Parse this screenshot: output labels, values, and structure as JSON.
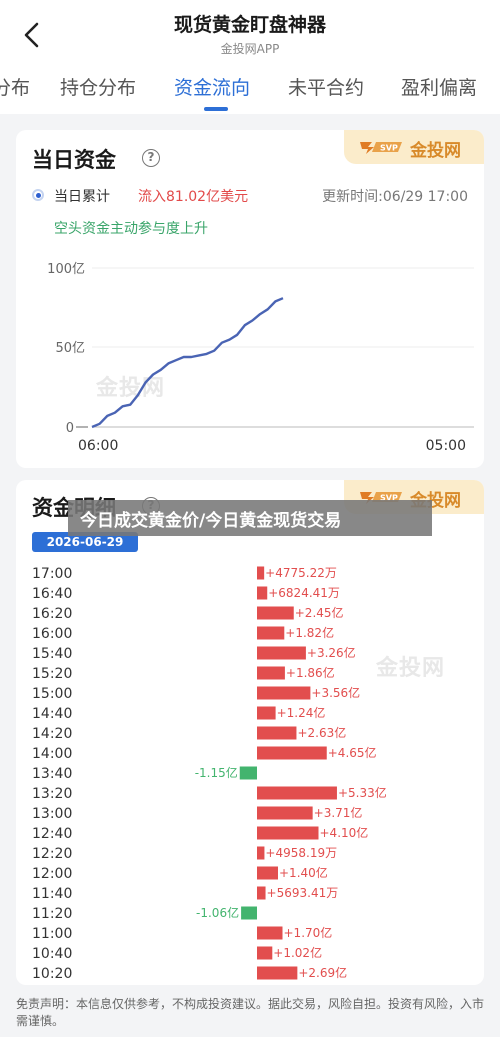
{
  "header": {
    "title": "现货黄金盯盘神器",
    "subtitle": "金投网APP"
  },
  "tabs": [
    {
      "label": "分布",
      "active": false
    },
    {
      "label": "持仓分布",
      "active": false
    },
    {
      "label": "资金流向",
      "active": true
    },
    {
      "label": "未平合约",
      "active": false
    },
    {
      "label": "盈利偏离",
      "active": false
    }
  ],
  "brand": {
    "name": "金投网",
    "watermark": "金投网"
  },
  "daily": {
    "title": "当日资金",
    "legend_label": "当日累计",
    "inflow_text": "流入81.02亿美元",
    "updated_text": "更新时间:06/29 17:00",
    "sentiment_text": "空头资金主动参与度上升",
    "chart_data": {
      "type": "line",
      "x_labels": [
        "06:00",
        "05:00"
      ],
      "y_ticks": [
        "100亿",
        "50亿",
        "0"
      ],
      "ylim": [
        0,
        100
      ],
      "x_fraction": [
        0,
        0.02,
        0.04,
        0.06,
        0.08,
        0.1,
        0.12,
        0.14,
        0.16,
        0.18,
        0.2,
        0.22,
        0.24,
        0.26,
        0.28,
        0.3,
        0.32,
        0.34,
        0.36,
        0.38,
        0.4,
        0.42,
        0.44,
        0.46,
        0.48,
        0.5
      ],
      "y": [
        0,
        2,
        7,
        9,
        13,
        14,
        20,
        28,
        33,
        36,
        40,
        42,
        44,
        44,
        45,
        46,
        48,
        53,
        55,
        58,
        64,
        67,
        71,
        74,
        79,
        81
      ],
      "color": "#4a64b4",
      "grid": "horizontal"
    }
  },
  "detail": {
    "title": "资金明细",
    "date": "2026-06-29",
    "chart_data": {
      "type": "bar",
      "orientation": "horizontal",
      "unit": "万",
      "categories": [
        "17:00",
        "16:40",
        "16:20",
        "16:00",
        "15:40",
        "15:20",
        "15:00",
        "14:40",
        "14:20",
        "14:00",
        "13:40",
        "13:20",
        "13:00",
        "12:40",
        "12:20",
        "12:00",
        "11:40",
        "11:20",
        "11:00",
        "10:40",
        "10:20"
      ],
      "values": [
        4775.22,
        6824.41,
        24500,
        18200,
        32600,
        18600,
        35600,
        12400,
        26300,
        46500,
        -11500,
        53300,
        37100,
        41000,
        4958.19,
        14000,
        5693.41,
        -10600,
        17000,
        10200,
        26900
      ],
      "labels": [
        "+4775.22万",
        "+6824.41万",
        "+2.45亿",
        "+1.82亿",
        "+3.26亿",
        "+1.86亿",
        "+3.56亿",
        "+1.24亿",
        "+2.63亿",
        "+4.65亿",
        "-1.15亿",
        "+5.33亿",
        "+3.71亿",
        "+4.10亿",
        "+4958.19万",
        "+1.40亿",
        "+5693.41万",
        "-1.06亿",
        "+1.70亿",
        "+1.02亿",
        "+2.69亿"
      ],
      "positive_color": "#e24e4e",
      "negative_color": "#43b46e"
    }
  },
  "overlay": {
    "text": "今日成交黄金价/今日黄金现货交易"
  },
  "footer": {
    "text": "免责声明：本信息仅供参考，不构成投资建议。据此交易，风险自担。投资有风险，入市需谨慎。"
  }
}
